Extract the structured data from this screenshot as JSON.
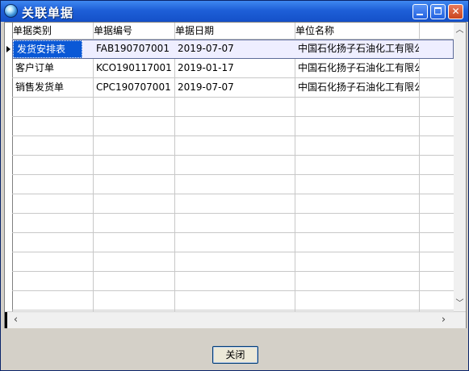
{
  "window": {
    "title": "关联单据"
  },
  "title_buttons": {
    "minimize": "minimize-icon",
    "maximize": "maximize-icon",
    "close": "close-icon"
  },
  "grid": {
    "columns": [
      "单据类别",
      "单据编号",
      "单据日期",
      "单位名称"
    ],
    "rows": [
      [
        "发货安排表",
        "FAB190707001",
        "2019-07-07",
        "中国石化扬子石油化工有限公"
      ],
      [
        "客户订单",
        "KCO190117001",
        "2019-01-17",
        "中国石化扬子石油化工有限公"
      ],
      [
        "销售发货单",
        "CPC190707001",
        "2019-07-07",
        "中国石化扬子石油化工有限公"
      ]
    ],
    "selected_row": 0
  },
  "footer": {
    "close_label": "关闭"
  },
  "colors": {
    "title_bar": "#1e5fd8",
    "selection": "#0a58d6",
    "grid_line": "#c8c8c8"
  }
}
